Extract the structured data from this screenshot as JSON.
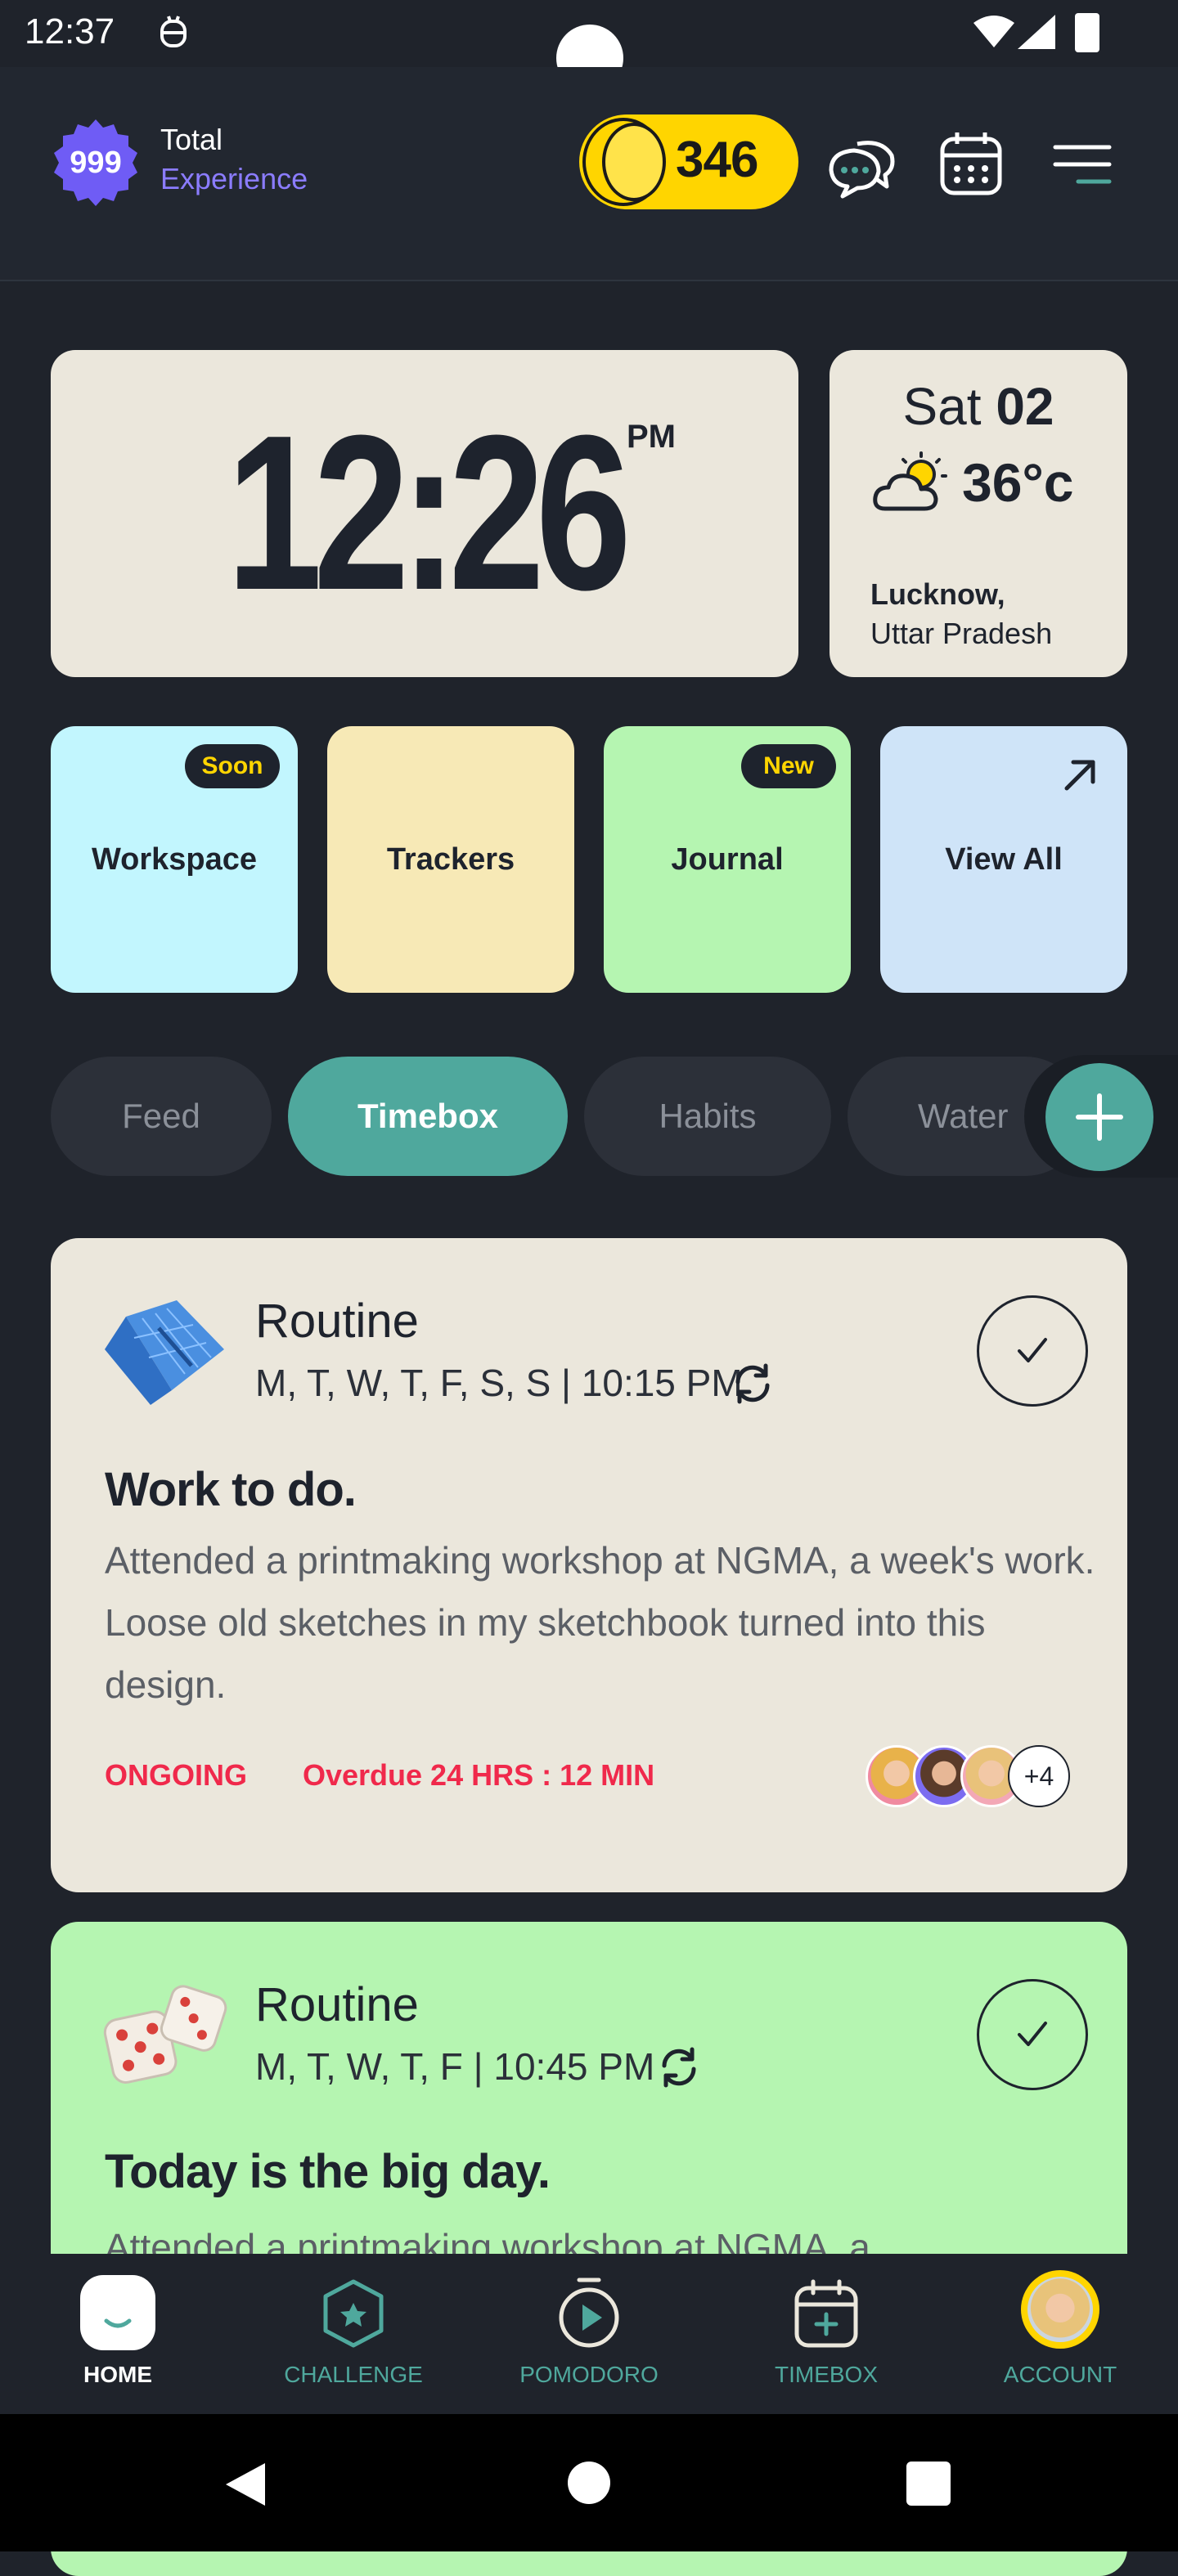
{
  "status_bar": {
    "time": "12:37"
  },
  "header": {
    "xp_value": "999",
    "xp_label_line1": "Total",
    "xp_label_line2": "Experience",
    "coins": "346",
    "icons": [
      "chat-icon",
      "calendar-icon",
      "menu-icon"
    ]
  },
  "clock": {
    "time": "12:26",
    "ampm": "PM"
  },
  "weather": {
    "day": "Sat",
    "date": "02",
    "temperature": "36°c",
    "city": "Lucknow,",
    "state": "Uttar Pradesh",
    "icon": "partly-cloudy-icon"
  },
  "tiles": [
    {
      "label": "Workspace",
      "badge": "Soon",
      "color": "#c2f6fe"
    },
    {
      "label": "Trackers",
      "badge": "",
      "color": "#f7e9b6"
    },
    {
      "label": "Journal",
      "badge": "New",
      "color": "#b5f5b1"
    },
    {
      "label": "View All",
      "badge": "",
      "color": "#cfe4f8"
    }
  ],
  "tabs": [
    {
      "label": "Feed",
      "active": false
    },
    {
      "label": "Timebox",
      "active": true
    },
    {
      "label": "Habits",
      "active": false
    },
    {
      "label": "Water",
      "active": false
    }
  ],
  "tasks": [
    {
      "category": "Routine",
      "schedule": "M, T, W, T, F, S, S | 10:15 PM",
      "title": "Work to do.",
      "description": "Attended a printmaking workshop at NGMA, a week's work. Loose old sketches in my sketchbook turned into this design.",
      "status": "ONGOING",
      "overdue": "Overdue 24 HRS : 12 MIN",
      "extra_participants": "+4",
      "icon": "blueprint-icon",
      "color": "#ebe7dc"
    },
    {
      "category": "Routine",
      "schedule": "M, T, W, T, F | 10:45 PM",
      "title": "Today is the big day.",
      "description": "Attended a printmaking workshop at NGMA, a",
      "icon": "dice-icon",
      "color": "#b5f5b1"
    }
  ],
  "nav": [
    {
      "label": "HOME",
      "active": true
    },
    {
      "label": "CHALLENGE",
      "active": false
    },
    {
      "label": "POMODORO",
      "active": false
    },
    {
      "label": "TIMEBOX",
      "active": false
    },
    {
      "label": "ACCOUNT",
      "active": false
    }
  ],
  "colors": {
    "accent": "#4fa89d",
    "alert": "#f0294b",
    "coin": "#ffd500",
    "xp": "#8b7cff"
  }
}
